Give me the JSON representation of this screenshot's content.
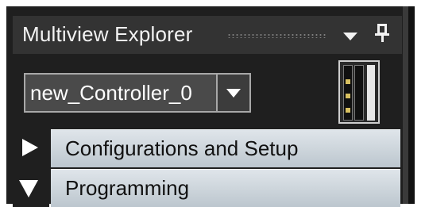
{
  "panel": {
    "title": "Multiview Explorer",
    "icons": {
      "dropdown": "chevron-down-icon",
      "pin": "pin-icon",
      "grip": "drag-grip-icon"
    }
  },
  "controller": {
    "selected": "new_Controller_0",
    "icon": "controller-device-icon"
  },
  "tree": {
    "items": [
      {
        "label": "Configurations and Setup",
        "state": "collapsed"
      },
      {
        "label": "Programming",
        "state": "expanded"
      }
    ]
  },
  "colors": {
    "panel_bg": "#1f1f1f",
    "title_bar": "#333333",
    "item_bg": "#c9d1d7",
    "text_light": "#f2f2f2",
    "text_dark": "#111111"
  }
}
